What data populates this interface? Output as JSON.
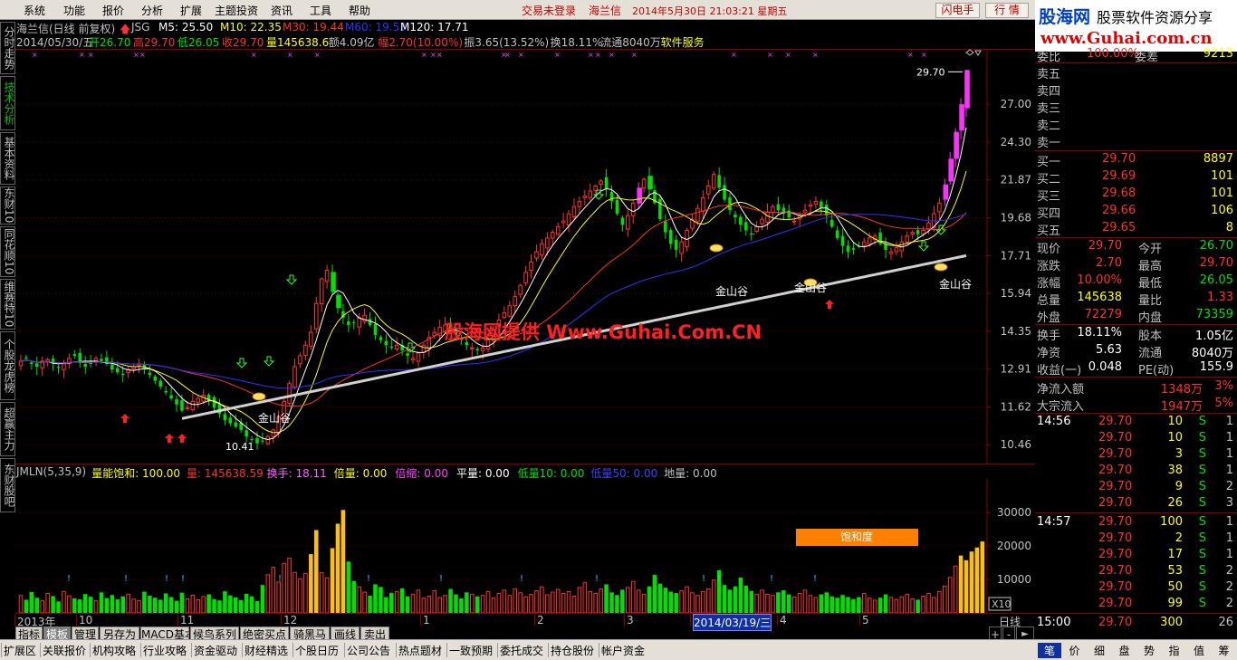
{
  "menubar": {
    "items": [
      "系统",
      "功能",
      "报价",
      "分析",
      "扩展",
      "主题投资",
      "资讯",
      "工具",
      "帮助"
    ],
    "status_login": "交易未登录",
    "status_stock": "海兰信",
    "datetime": "2014年5月30日 21:03:21 星期五",
    "btn_flash": "闪电手",
    "btn_quote": "行 情"
  },
  "logo": {
    "brand": "股海网",
    "slogan": "股票软件资源分享",
    "url": "www.Guhai.com.cn"
  },
  "left_tabs": [
    "分时走势",
    "技术分析",
    "基本资料",
    "东财10",
    "同花顺10",
    "维赛特10",
    "个股龙虎榜",
    "超赢主力",
    "东财股吧"
  ],
  "left_tab_active": 1,
  "chart_header": {
    "title": "海兰信(日线 前复权)",
    "code": "JSG",
    "ma_values": [
      {
        "label": "M5: 25.50",
        "color": "#ffffff"
      },
      {
        "label": "M10: 22.35",
        "color": "#ffff00"
      },
      {
        "label": "M30: 19.44",
        "color": "#ff3030"
      },
      {
        "label": "M60: 19.53",
        "color": "#3030ff"
      },
      {
        "label": "M120: 17.71",
        "color": "#ffffff"
      }
    ],
    "info_date": "2014/05/30/五",
    "info_items": [
      {
        "label": "开26.70",
        "color": "#00e000"
      },
      {
        "label": "高29.70",
        "color": "#ff3030"
      },
      {
        "label": "低26.05",
        "color": "#00e000"
      },
      {
        "label": "收29.70",
        "color": "#ff3030"
      },
      {
        "label": "量145638.6",
        "color": "#ffff00"
      },
      {
        "label": "额4.09亿",
        "color": "#c0c0c0"
      },
      {
        "label": "幅2.70(10.00%)",
        "color": "#ff3030"
      },
      {
        "label": "振3.65(13.52%)",
        "color": "#c0c0c0"
      },
      {
        "label": "换18.11%",
        "color": "#c0c0c0"
      },
      {
        "label": "流通8040万",
        "color": "#c0c0c0"
      },
      {
        "label": "软件服务",
        "color": "#ffff00"
      }
    ]
  },
  "chart_labels": {
    "watermark": "股海网提供 Www.Guhai.Com.CN",
    "golden_valley": "金山谷",
    "high_label": "29.70",
    "low_label": "10.41",
    "saturation": "饱和度",
    "x10": "X10"
  },
  "indicator_header": [
    {
      "label": "JMLN(5,35,9)",
      "color": "#c0c0c0"
    },
    {
      "label": "量能饱和: 100.00",
      "color": "#ffff00"
    },
    {
      "label": "量: 145638.59",
      "color": "#ff3030"
    },
    {
      "label": "换手: 18.11",
      "color": "#ff60ff"
    },
    {
      "label": "倍量: 0.00",
      "color": "#ffff00"
    },
    {
      "label": "倍缩: 0.00",
      "color": "#ff40ff"
    },
    {
      "label": "平量: 0.00",
      "color": "#ffffff"
    },
    {
      "label": "低量10: 0.00",
      "color": "#00e000"
    },
    {
      "label": "低量50: 0.00",
      "color": "#4040ff"
    },
    {
      "label": "地量: 0.00",
      "color": "#c0c0c0"
    }
  ],
  "time_axis": {
    "labels": [
      "2013年",
      "10",
      "11",
      "12",
      "1",
      "2",
      "3",
      "2014/03/19/三",
      "4",
      "5"
    ],
    "period": "日线"
  },
  "func_tabs": [
    "指标",
    "模板",
    "管理",
    "另存为",
    "MACD基本",
    "候鸟系列",
    "绝密买点",
    "骑黑马",
    "画线",
    "卖出"
  ],
  "func_tab_active": 1,
  "bottom_tabs": [
    "扩展区",
    "关联报价",
    "机构攻略",
    "行业攻略",
    "资金驱动",
    "财经精选",
    "个股日历",
    "公司公告",
    "热点题材",
    "一致预期",
    "委托成交",
    "持仓股份",
    "帐户资金"
  ],
  "right_bottom_tabs": [
    "笔",
    "价",
    "细",
    "盘",
    "势",
    "指",
    "值",
    "筹"
  ],
  "quote": {
    "weibi_label": "委比",
    "weibi": "100.00%",
    "weicha_label": "委差",
    "weicha": "9213",
    "asks": [
      {
        "label": "卖五",
        "price": "",
        "vol": ""
      },
      {
        "label": "卖四",
        "price": "",
        "vol": ""
      },
      {
        "label": "卖三",
        "price": "",
        "vol": ""
      },
      {
        "label": "卖二",
        "price": "",
        "vol": ""
      },
      {
        "label": "卖一",
        "price": "",
        "vol": ""
      }
    ],
    "bids": [
      {
        "label": "买一",
        "price": "29.70",
        "vol": "8897"
      },
      {
        "label": "买二",
        "price": "29.69",
        "vol": "101"
      },
      {
        "label": "买三",
        "price": "29.68",
        "vol": "101"
      },
      {
        "label": "买四",
        "price": "29.66",
        "vol": "106"
      },
      {
        "label": "买五",
        "price": "29.65",
        "vol": "8"
      }
    ],
    "stats": [
      {
        "l1": "现价",
        "v1": "29.70",
        "c1": "#ff3030",
        "l2": "今开",
        "v2": "26.70",
        "c2": "#00e000"
      },
      {
        "l1": "涨跌",
        "v1": "2.70",
        "c1": "#ff3030",
        "l2": "最高",
        "v2": "29.70",
        "c2": "#ff3030"
      },
      {
        "l1": "涨幅",
        "v1": "10.00%",
        "c1": "#ff3030",
        "l2": "最低",
        "v2": "26.05",
        "c2": "#00e000"
      },
      {
        "l1": "总量",
        "v1": "145638",
        "c1": "#ffff00",
        "l2": "量比",
        "v2": "1.33",
        "c2": "#ff3030"
      },
      {
        "l1": "外盘",
        "v1": "72279",
        "c1": "#ff3030",
        "l2": "内盘",
        "v2": "73359",
        "c2": "#00e000"
      }
    ],
    "stats2": [
      {
        "l1": "换手",
        "v1": "18.11%",
        "l2": "股本",
        "v2": "1.05亿"
      },
      {
        "l1": "净资",
        "v1": "5.63",
        "l2": "流通",
        "v2": "8040万"
      },
      {
        "l1": "收益(一)",
        "v1": "0.048",
        "l2": "PE(动)",
        "v2": "155.9"
      }
    ],
    "flows": [
      {
        "label": "净流入额",
        "value": "1348万",
        "pct": "3%"
      },
      {
        "label": "大宗流入",
        "value": "1947万",
        "pct": "5%"
      }
    ],
    "ticks": [
      {
        "time": "14:56",
        "price": "29.70",
        "vol": "10",
        "bs": "S",
        "n": "1"
      },
      {
        "time": "",
        "price": "29.70",
        "vol": "10",
        "bs": "S",
        "n": "1"
      },
      {
        "time": "",
        "price": "29.70",
        "vol": "3",
        "bs": "S",
        "n": "1"
      },
      {
        "time": "",
        "price": "29.70",
        "vol": "38",
        "bs": "S",
        "n": "1"
      },
      {
        "time": "",
        "price": "29.70",
        "vol": "9",
        "bs": "S",
        "n": "2"
      },
      {
        "time": "",
        "price": "29.70",
        "vol": "26",
        "bs": "S",
        "n": "3"
      },
      {
        "time": "14:57",
        "price": "29.70",
        "vol": "100",
        "bs": "S",
        "n": "1"
      },
      {
        "time": "",
        "price": "29.70",
        "vol": "2",
        "bs": "S",
        "n": "1"
      },
      {
        "time": "",
        "price": "29.70",
        "vol": "17",
        "bs": "S",
        "n": "1"
      },
      {
        "time": "",
        "price": "29.70",
        "vol": "53",
        "bs": "S",
        "n": "2"
      },
      {
        "time": "",
        "price": "29.70",
        "vol": "50",
        "bs": "S",
        "n": "2"
      },
      {
        "time": "",
        "price": "29.70",
        "vol": "99",
        "bs": "S",
        "n": "2"
      },
      {
        "time": "15:00",
        "price": "29.70",
        "vol": "300",
        "bs": "",
        "n": "26"
      }
    ]
  },
  "chart_data": [
    {
      "type": "candlestick",
      "title": "海兰信(日线 前复权)",
      "y_scale": "log",
      "ylim": [
        9.9,
        31.5
      ],
      "y_ticks": [
        10.46,
        11.62,
        12.91,
        14.35,
        15.94,
        17.71,
        19.68,
        21.87,
        24.3,
        27.0
      ],
      "x": {
        "start": "2013-09-02",
        "end": "2014-05-30",
        "tick_labels": [
          "2013年",
          "10",
          "11",
          "12",
          "1",
          "2",
          "3",
          "4",
          "5"
        ]
      },
      "series": [
        {
          "name": "M5",
          "value": 25.5
        },
        {
          "name": "M10",
          "value": 22.35
        },
        {
          "name": "M30",
          "value": 19.44
        },
        {
          "name": "M60",
          "value": 19.53
        },
        {
          "name": "M120",
          "value": 17.71
        }
      ],
      "closes": [
        13.2,
        13.3,
        13.1,
        13.0,
        13.2,
        13.25,
        13.1,
        12.95,
        13.1,
        13.3,
        13.4,
        13.2,
        13.0,
        13.1,
        13.3,
        13.2,
        13.1,
        12.9,
        12.8,
        12.7,
        12.9,
        13.0,
        13.1,
        12.9,
        12.7,
        12.5,
        12.3,
        12.1,
        11.9,
        11.7,
        11.5,
        11.6,
        11.8,
        11.9,
        12.0,
        11.8,
        11.6,
        11.4,
        11.2,
        11.1,
        11.0,
        10.9,
        10.7,
        10.6,
        10.5,
        10.55,
        10.7,
        10.9,
        11.3,
        11.8,
        12.4,
        13.0,
        13.4,
        13.8,
        14.3,
        15.5,
        16.6,
        17.0,
        16.0,
        15.3,
        14.9,
        14.6,
        14.7,
        14.9,
        15.0,
        14.6,
        14.2,
        14.0,
        13.8,
        13.7,
        13.8,
        13.6,
        13.4,
        13.3,
        13.5,
        13.8,
        14.1,
        14.3,
        14.5,
        14.6,
        14.4,
        14.2,
        14.0,
        13.8,
        13.7,
        13.6,
        13.7,
        14.0,
        14.4,
        14.8,
        15.1,
        15.4,
        15.8,
        16.3,
        16.9,
        17.4,
        17.9,
        18.3,
        18.6,
        18.9,
        19.2,
        19.5,
        19.9,
        20.3,
        20.6,
        20.9,
        21.2,
        21.5,
        21.8,
        21.3,
        20.6,
        19.9,
        19.3,
        19.8,
        20.5,
        21.4,
        21.9,
        21.3,
        20.5,
        19.6,
        18.9,
        18.3,
        18.0,
        18.4,
        19.0,
        19.6,
        20.2,
        20.8,
        21.5,
        22.2,
        21.4,
        20.7,
        20.1,
        19.7,
        19.3,
        19.0,
        18.8,
        19.2,
        19.6,
        20.0,
        20.3,
        20.1,
        19.9,
        19.7,
        19.5,
        19.8,
        20.1,
        20.4,
        20.6,
        20.2,
        19.8,
        19.2,
        18.6,
        18.2,
        17.9,
        18.0,
        18.2,
        18.4,
        18.6,
        18.7,
        18.3,
        18.0,
        17.9,
        18.1,
        18.4,
        18.7,
        18.9,
        18.8,
        19.0,
        19.4,
        19.9,
        20.5,
        21.6,
        23.2,
        25.0,
        27.0,
        29.7
      ],
      "annotations": [
        "金山谷",
        "金山谷",
        "金山谷",
        "金山谷",
        "29.70",
        "10.41"
      ]
    },
    {
      "type": "bar",
      "title": "JMLN(5,35,9)",
      "ylim": [
        0,
        40000
      ],
      "y_ticks": [
        10000,
        20000,
        30000
      ],
      "values": [
        5.2,
        3.8,
        6.1,
        4.4,
        3.6,
        5.8,
        4.9,
        3.3,
        6.4,
        5.1,
        4.2,
        3.9,
        5.5,
        4.7,
        3.6,
        6.0,
        4.3,
        5.2,
        3.9,
        4.8,
        5.6,
        4.1,
        3.7,
        6.2,
        5.0,
        4.4,
        3.8,
        5.7,
        4.6,
        3.5,
        5.9,
        4.2,
        5.3,
        3.9,
        4.9,
        5.4,
        4.0,
        3.6,
        6.3,
        5.1,
        4.5,
        3.7,
        5.6,
        4.8,
        3.4,
        8.2,
        11.4,
        13.6,
        9.2,
        14.8,
        16.4,
        12.1,
        10.2,
        11.8,
        17.4,
        24.6,
        12.0,
        10.5,
        19.2,
        26.5,
        30.6,
        15.2,
        9.4,
        7.8,
        6.2,
        5.0,
        8.4,
        7.6,
        4.6,
        5.8,
        6.4,
        7.2,
        4.8,
        5.6,
        6.8,
        4.4,
        5.0,
        6.6,
        4.6,
        5.2,
        7.0,
        5.4,
        4.2,
        6.0,
        5.6,
        4.8,
        5.2,
        6.4,
        4.5,
        5.8,
        6.8,
        5.2,
        7.2,
        6.0,
        4.8,
        5.5,
        6.6,
        7.8,
        5.4,
        6.2,
        7.0,
        5.8,
        6.4,
        5.0,
        7.6,
        9.0,
        6.4,
        5.8,
        7.2,
        8.4,
        6.0,
        5.2,
        6.8,
        7.6,
        9.4,
        6.8,
        5.6,
        7.8,
        11.2,
        8.6,
        7.4,
        6.2,
        5.8,
        6.6,
        7.8,
        6.0,
        5.2,
        6.4,
        7.2,
        9.8,
        12.6,
        8.2,
        6.8,
        7.8,
        10.4,
        8.0,
        6.4,
        5.6,
        6.8,
        5.6,
        5.2,
        6.0,
        6.6,
        5.4,
        4.8,
        5.8,
        6.8,
        5.2,
        4.6,
        5.4,
        6.0,
        4.8,
        4.4,
        5.2,
        4.6,
        4.0,
        4.6,
        5.8,
        4.4,
        3.8,
        4.4,
        5.4,
        4.6,
        4.0,
        4.8,
        5.6,
        4.2,
        3.8,
        5.0,
        5.8,
        4.6,
        6.4,
        8.0,
        10.6,
        14.0,
        17.0,
        15.6,
        18.2,
        19.4,
        21.2
      ]
    }
  ]
}
